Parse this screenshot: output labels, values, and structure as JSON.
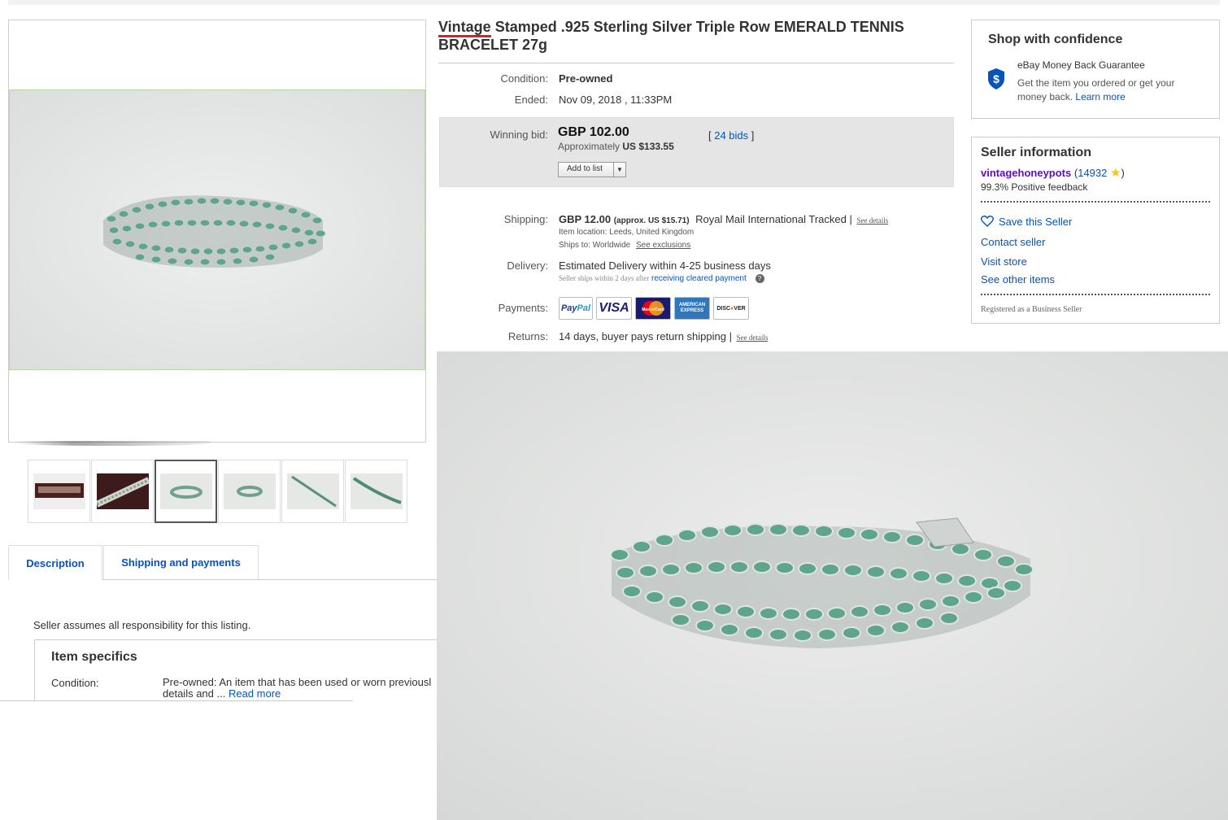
{
  "listing": {
    "title_highlight": "Vintage",
    "title_rest": " Stamped .925 Sterling Silver Triple Row EMERALD TENNIS BRACELET 27g"
  },
  "details": {
    "condition_label": "Condition:",
    "condition_value": "Pre-owned",
    "ended_label": "Ended:",
    "ended_value": "Nov 09, 2018 , 11:33PM",
    "winning_label": "Winning bid:",
    "price": "GBP 102.00",
    "approx_prefix": "Approximately",
    "approx_value": "US $133.55",
    "bids_open": "[ ",
    "bids_link": "24 bids",
    "bids_close": " ]",
    "add_to_list": "Add to list",
    "shipping_label": "Shipping:",
    "shipping_price": "GBP 12.00",
    "shipping_approx": "(approx. US $15.71)",
    "shipping_service": "Royal Mail International Tracked |",
    "see_details": "See details",
    "item_location": "Item location:  Leeds, United Kingdom",
    "ships_to": "Ships to:  Worldwide",
    "see_exclusions": "See exclusions",
    "delivery_label": "Delivery:",
    "delivery_value": "Estimated Delivery within 4-25 business days",
    "seller_ships": "Seller ships within 2 days after",
    "receiving_payment": "receiving cleared payment",
    "payments_label": "Payments:",
    "returns_label": "Returns:",
    "returns_value": "14 days, buyer pays return shipping |",
    "returns_see_details": "See details"
  },
  "payment_logos": [
    "PayPal",
    "VISA",
    "MasterCard",
    "AMERICAN EXPRESS",
    "DISCOVER"
  ],
  "confidence": {
    "title": "Shop with confidence",
    "subtitle": "eBay Money Back Guarantee",
    "text": "Get the item you ordered or get your money back.",
    "learn_more": "Learn more"
  },
  "seller": {
    "title": "Seller information",
    "name": "vintagehoneypots",
    "score": "14932",
    "feedback": "99.3% Positive feedback",
    "save": "Save this Seller",
    "contact": "Contact seller",
    "visit": "Visit store",
    "other": "See other items",
    "registered": "Registered as a Business Seller"
  },
  "tabs": {
    "description": "Description",
    "shipping": "Shipping and payments"
  },
  "description": {
    "disclaimer": "Seller assumes all responsibility for this listing.",
    "specifics_title": "Item specifics",
    "condition_label": "Condition:",
    "condition_value": "Pre-owned: An item that has been used or worn previousl",
    "condition_value2": "details and ...",
    "read_more": "Read more"
  },
  "colors": {
    "link": "#0654ba",
    "seller_name": "#5f0cbf",
    "highlight_underline": "#e0201f",
    "emerald": "#5fa58c"
  },
  "icons": [
    "shield-dollar-icon",
    "heart-icon",
    "star-icon",
    "help-icon",
    "chevron-down-icon"
  ]
}
